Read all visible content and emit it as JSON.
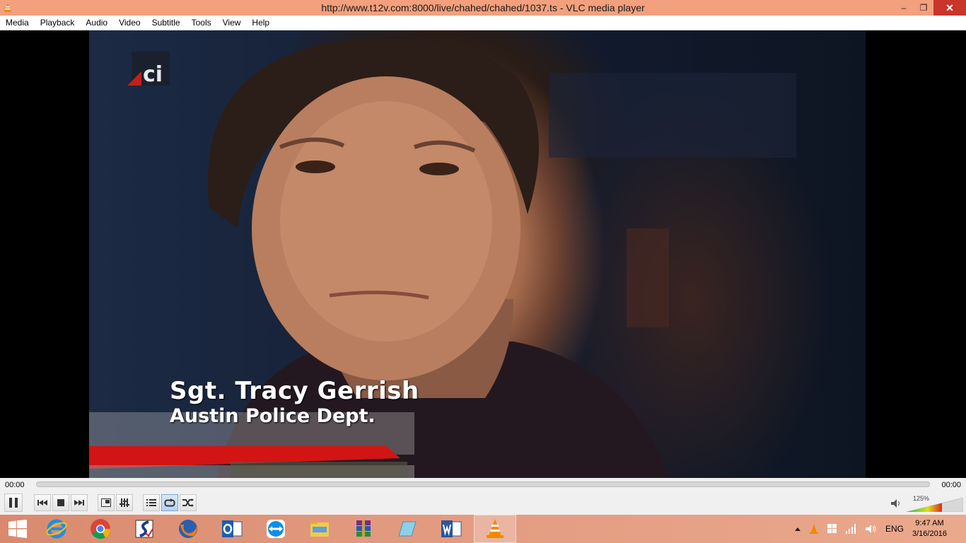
{
  "window": {
    "title": "http://www.t12v.com:8000/live/chahed/chahed/1037.ts - VLC media player",
    "minimize_label": "–",
    "restore_label": "❐",
    "close_label": "✕"
  },
  "menu": {
    "items": [
      "Media",
      "Playback",
      "Audio",
      "Video",
      "Subtitle",
      "Tools",
      "View",
      "Help"
    ]
  },
  "video": {
    "channel_logo_text": "ci",
    "lower_third": {
      "name": "Sgt. Tracy Gerrish",
      "organization": "Austin Police Dept."
    }
  },
  "playback": {
    "elapsed": "00:00",
    "total": "00:00",
    "position_fraction": 0
  },
  "volume": {
    "percent_label": "125%",
    "level_percent": 125
  },
  "taskbar": {
    "apps": [
      "internet-explorer",
      "chrome",
      "setup-tool",
      "firefox",
      "outlook",
      "teamviewer",
      "file-explorer",
      "winrar",
      "notes-app",
      "word",
      "vlc"
    ],
    "active_app": "vlc"
  },
  "tray": {
    "language": "ENG",
    "time": "9:47 AM",
    "date": "3/16/2016"
  },
  "colors": {
    "titlebar": "#f2a07e",
    "close_button": "#c7352b",
    "taskbar": "#e29a7f",
    "vlc_orange": "#f08a00"
  }
}
